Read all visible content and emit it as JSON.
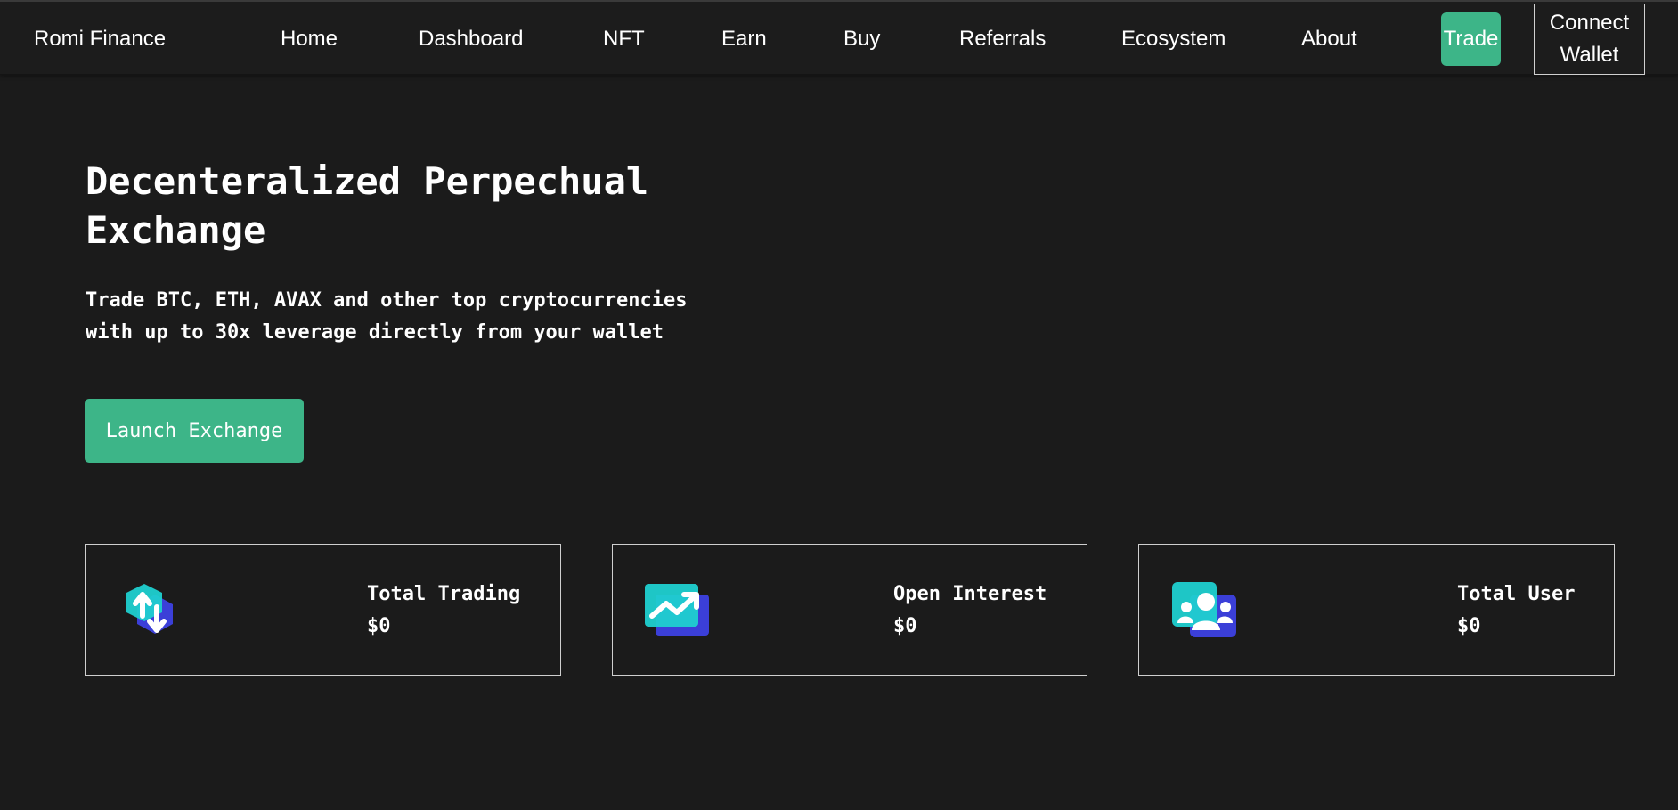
{
  "nav": {
    "brand": "Romi Finance",
    "links": [
      "Home",
      "Dashboard",
      "NFT",
      "Earn",
      "Buy",
      "Referrals",
      "Ecosystem",
      "About"
    ],
    "trade_label": "Trade",
    "wallet_label": "Connect Wallet"
  },
  "hero": {
    "title": "Decenteralized Perpechual Exchange",
    "subtitle": "Trade BTC, ETH, AVAX and other top cryptocurrencies with up to 30x leverage directly from your wallet",
    "cta_label": "Launch Exchange"
  },
  "stats": [
    {
      "label": "Total Trading",
      "value": "$0",
      "icon": "trading-swap-icon"
    },
    {
      "label": "Open Interest",
      "value": "$0",
      "icon": "trend-chart-icon"
    },
    {
      "label": "Total User",
      "value": "$0",
      "icon": "users-group-icon"
    }
  ],
  "colors": {
    "background": "#1b1b1b",
    "accent": "#3db588",
    "icon_teal": "#1fd0d0",
    "icon_indigo": "#3b3fd8"
  }
}
